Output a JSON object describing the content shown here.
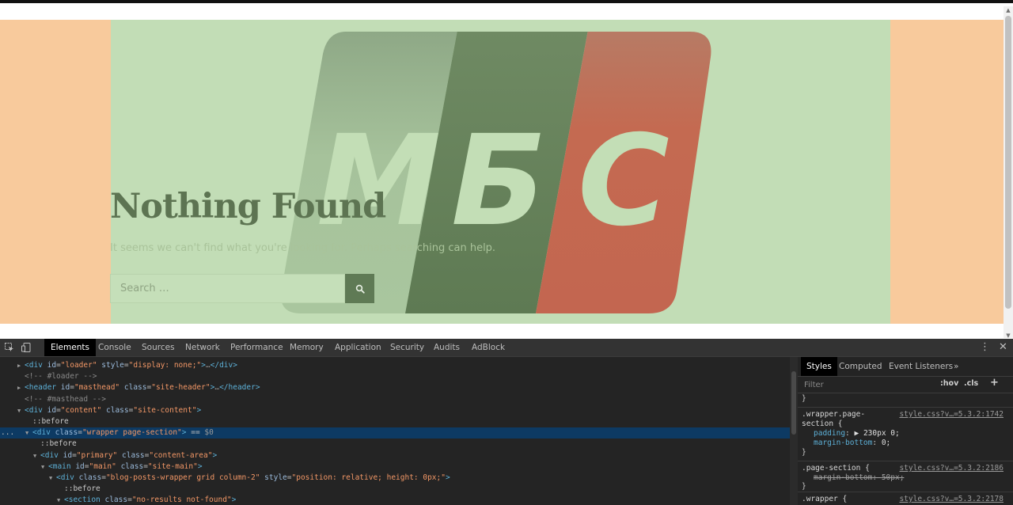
{
  "page": {
    "title": "Nothing Found",
    "subtitle": "It seems we can't find what you're looking for. Perhaps searching can help.",
    "search_placeholder": "Search …",
    "logo_letters": [
      "М",
      "Б",
      "С"
    ]
  },
  "colors": {
    "peach": "#f8ca9c",
    "light_green": "#c2ddb6",
    "dark_green": "#5f7a55",
    "brand_red": "#c26750",
    "devtools_bg": "#242424"
  },
  "devtools": {
    "tabs": [
      "Elements",
      "Console",
      "Sources",
      "Network",
      "Performance",
      "Memory",
      "Application",
      "Security",
      "Audits",
      "AdBlock"
    ],
    "active_tab": "Elements",
    "dom_lines": [
      {
        "indent": 1,
        "tri": "▶",
        "parts": [
          [
            "tg",
            "<div "
          ],
          [
            "an",
            "id"
          ],
          [
            "eq",
            "="
          ],
          [
            "av",
            "\"loader\""
          ],
          [
            "tg",
            " "
          ],
          [
            "an",
            "style"
          ],
          [
            "eq",
            "="
          ],
          [
            "av",
            "\"display: none;\""
          ],
          [
            "tg",
            ">"
          ],
          [
            "dl",
            "…"
          ],
          [
            "tg",
            "</div>"
          ]
        ]
      },
      {
        "indent": 1,
        "tri": "",
        "parts": [
          [
            "cm",
            "<!-- #loader -->"
          ]
        ]
      },
      {
        "indent": 1,
        "tri": "▶",
        "parts": [
          [
            "tg",
            "<header "
          ],
          [
            "an",
            "id"
          ],
          [
            "eq",
            "="
          ],
          [
            "av",
            "\"masthead\""
          ],
          [
            "tg",
            " "
          ],
          [
            "an",
            "class"
          ],
          [
            "eq",
            "="
          ],
          [
            "av",
            "\"site-header\""
          ],
          [
            "tg",
            ">"
          ],
          [
            "dl",
            "…"
          ],
          [
            "tg",
            "</header>"
          ]
        ]
      },
      {
        "indent": 1,
        "tri": "",
        "parts": [
          [
            "cm",
            "<!-- #masthead -->"
          ]
        ]
      },
      {
        "indent": 1,
        "tri": "▼",
        "parts": [
          [
            "tg",
            "<div "
          ],
          [
            "an",
            "id"
          ],
          [
            "eq",
            "="
          ],
          [
            "av",
            "\"content\""
          ],
          [
            "tg",
            " "
          ],
          [
            "an",
            "class"
          ],
          [
            "eq",
            "="
          ],
          [
            "av",
            "\"site-content\""
          ],
          [
            "tg",
            ">"
          ]
        ]
      },
      {
        "indent": 2,
        "tri": "",
        "parts": [
          [
            "ps",
            "::before"
          ]
        ]
      },
      {
        "indent": 2,
        "tri": "▼",
        "selected": true,
        "parts": [
          [
            "tg",
            "<div "
          ],
          [
            "an",
            "class"
          ],
          [
            "eq",
            "="
          ],
          [
            "av",
            "\"wrapper page-section\""
          ],
          [
            "tg",
            ">"
          ],
          [
            "eq",
            " == "
          ],
          [
            "dl",
            "$0"
          ]
        ]
      },
      {
        "indent": 3,
        "tri": "",
        "parts": [
          [
            "ps",
            "::before"
          ]
        ]
      },
      {
        "indent": 3,
        "tri": "▼",
        "parts": [
          [
            "tg",
            "<div "
          ],
          [
            "an",
            "id"
          ],
          [
            "eq",
            "="
          ],
          [
            "av",
            "\"primary\""
          ],
          [
            "tg",
            " "
          ],
          [
            "an",
            "class"
          ],
          [
            "eq",
            "="
          ],
          [
            "av",
            "\"content-area\""
          ],
          [
            "tg",
            ">"
          ]
        ]
      },
      {
        "indent": 4,
        "tri": "▼",
        "parts": [
          [
            "tg",
            "<main "
          ],
          [
            "an",
            "id"
          ],
          [
            "eq",
            "="
          ],
          [
            "av",
            "\"main\""
          ],
          [
            "tg",
            " "
          ],
          [
            "an",
            "class"
          ],
          [
            "eq",
            "="
          ],
          [
            "av",
            "\"site-main\""
          ],
          [
            "tg",
            ">"
          ]
        ]
      },
      {
        "indent": 5,
        "tri": "▼",
        "parts": [
          [
            "tg",
            "<div "
          ],
          [
            "an",
            "class"
          ],
          [
            "eq",
            "="
          ],
          [
            "av",
            "\"blog-posts-wrapper grid column-2\""
          ],
          [
            "tg",
            " "
          ],
          [
            "an",
            "style"
          ],
          [
            "eq",
            "="
          ],
          [
            "av",
            "\"position: relative; height: 0px;\""
          ],
          [
            "tg",
            ">"
          ]
        ]
      },
      {
        "indent": 6,
        "tri": "",
        "parts": [
          [
            "ps",
            "::before"
          ]
        ]
      },
      {
        "indent": 6,
        "tri": "▼",
        "parts": [
          [
            "tg",
            "<section "
          ],
          [
            "an",
            "class"
          ],
          [
            "eq",
            "="
          ],
          [
            "av",
            "\"no-results not-found\""
          ],
          [
            "tg",
            ">"
          ]
        ]
      }
    ],
    "selected_marker": "...",
    "styles_tabs": [
      "Styles",
      "Computed",
      "Event Listeners"
    ],
    "styles_more": "»",
    "filter_placeholder": "Filter",
    "hov_label": ":hov",
    "cls_label": ".cls",
    "add_label": "+",
    "brace_close": "}",
    "rules": [
      {
        "selector": ".wrapper.page-section",
        "selector_wrap": [
          ".wrapper.page-",
          "section {"
        ],
        "source": "style.css?v…=5.3.2:1742",
        "props": [
          [
            "padding",
            "▶ 230px 0;",
            false
          ],
          [
            "margin-bottom",
            "0;",
            false
          ]
        ]
      },
      {
        "selector": ".page-section {",
        "source": "style.css?v…=5.3.2:2186",
        "props": [
          [
            "margin-bottom",
            "50px;",
            true
          ]
        ]
      },
      {
        "selector": ".wrapper {",
        "source": "style.css?v…=5.3.2:2178",
        "props": []
      }
    ]
  }
}
